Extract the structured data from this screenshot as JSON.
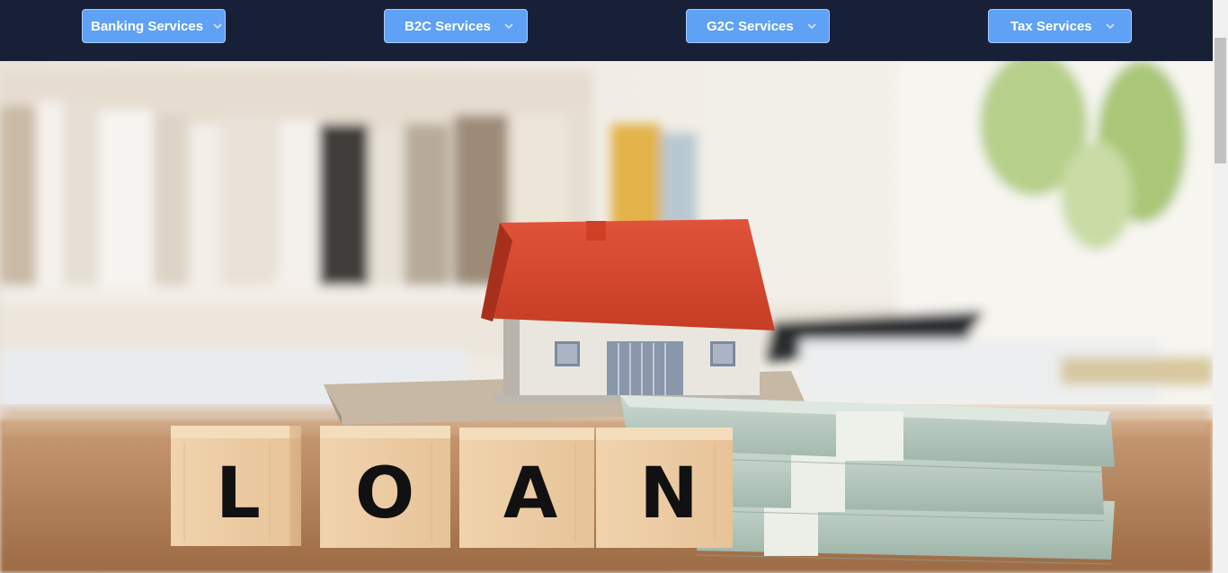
{
  "nav": {
    "items": [
      {
        "label": "Banking Services",
        "icon": "chevron-down-icon"
      },
      {
        "label": "B2C Services",
        "icon": "chevron-down-icon"
      },
      {
        "label": "G2C Services",
        "icon": "chevron-down-icon"
      },
      {
        "label": "Tax Services",
        "icon": "chevron-down-icon"
      }
    ]
  },
  "hero": {
    "letters": [
      "L",
      "O",
      "A",
      "N"
    ]
  },
  "colors": {
    "nav_bg": "#172036",
    "button_bg": "#5ea1f5",
    "roof": "#d8472d"
  }
}
